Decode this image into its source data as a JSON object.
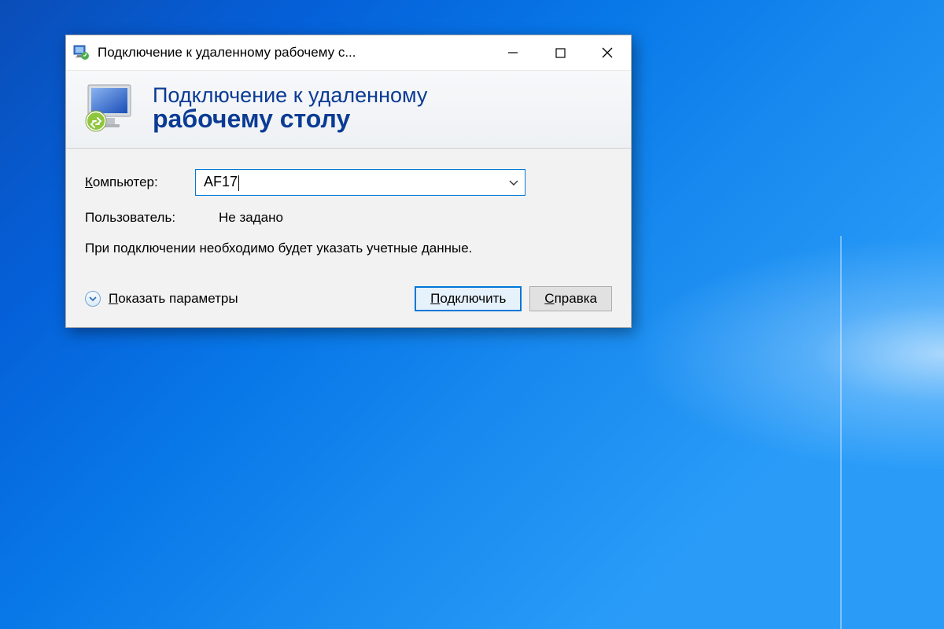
{
  "window": {
    "title": "Подключение к удаленному рабочему с..."
  },
  "banner": {
    "line1": "Подключение к удаленному",
    "line2": "рабочему столу"
  },
  "form": {
    "computer_label": "Компьютер:",
    "computer_value": "AF17",
    "user_label": "Пользователь:",
    "user_value": "Не задано",
    "hint": "При подключении необходимо будет указать учетные данные."
  },
  "footer": {
    "show_params_prefix": "П",
    "show_params_rest": "оказать параметры",
    "connect_prefix": "П",
    "connect_rest": "одключить",
    "help_prefix": "С",
    "help_rest": "правка"
  }
}
